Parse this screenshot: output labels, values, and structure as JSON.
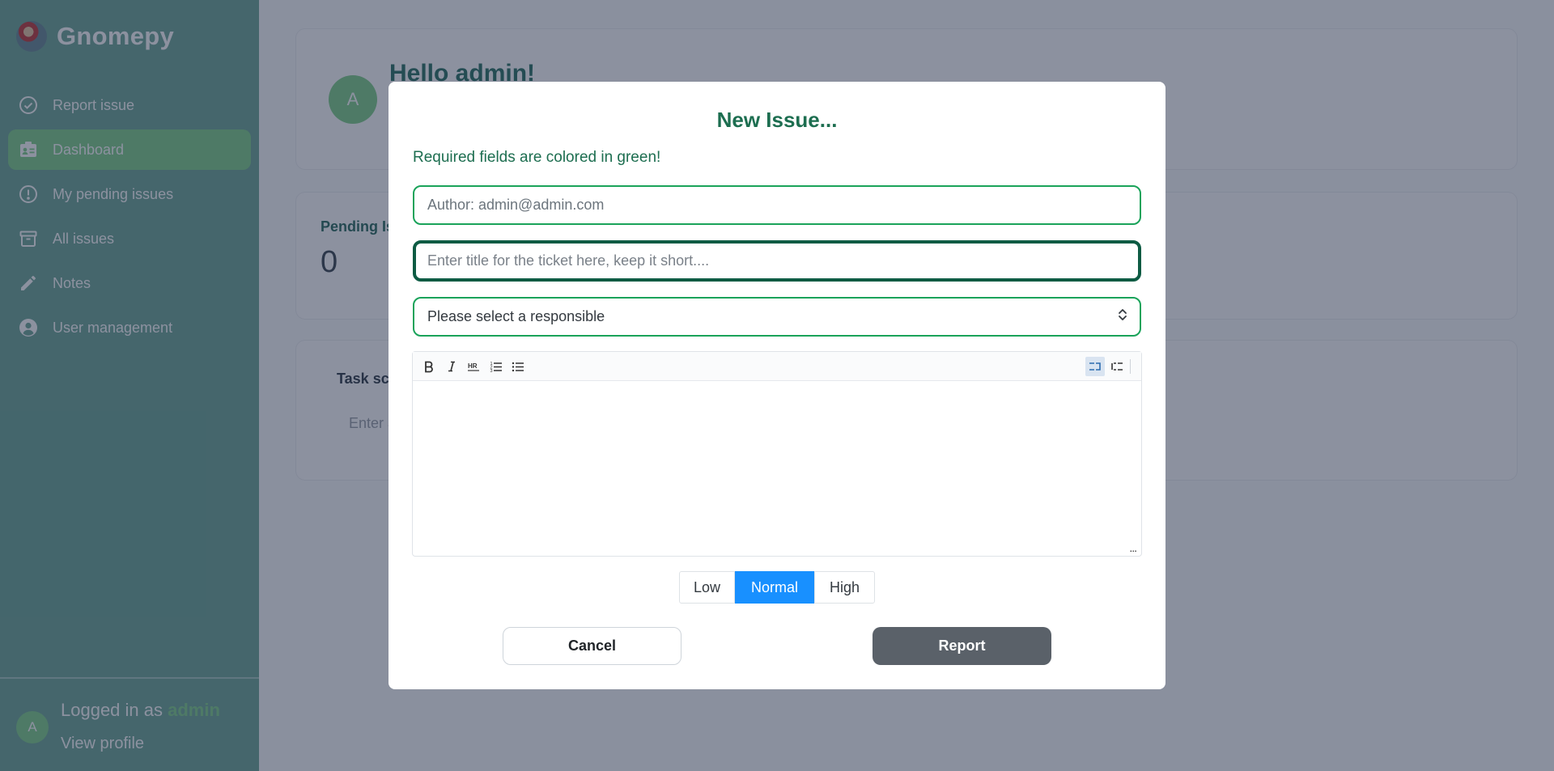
{
  "app": {
    "brand": "Gnomepy"
  },
  "sidebar": {
    "items": [
      {
        "label": "Report issue",
        "icon": "check-circle-icon"
      },
      {
        "label": "Dashboard",
        "icon": "id-card-icon"
      },
      {
        "label": "My pending issues",
        "icon": "exclamation-circle-icon"
      },
      {
        "label": "All issues",
        "icon": "archive-icon"
      },
      {
        "label": "Notes",
        "icon": "pencil-icon"
      },
      {
        "label": "User management",
        "icon": "user-circle-icon"
      }
    ],
    "active_item": "Dashboard",
    "footer": {
      "avatar_letter": "A",
      "logged_in_prefix": "Logged in as ",
      "username": "admin",
      "view_profile": "View profile"
    }
  },
  "dashboard": {
    "avatar_letter": "A",
    "greeting": "Hello admin!",
    "pending_title": "Pending Is",
    "pending_value": "0",
    "task_title": "Task sch",
    "task_placeholder": "Enter a"
  },
  "modal": {
    "title": "New Issue...",
    "required_note": "Required fields are colored in green!",
    "author_field": "Author: admin@admin.com",
    "title_placeholder": "Enter title for the ticket here, keep it short....",
    "responsible_select": "Please select a responsible",
    "editor": {
      "toolbar": [
        "bold-icon",
        "italic-icon",
        "hr-icon",
        "ordered-list-icon",
        "unordered-list-icon",
        "source-view-icon",
        "wysiwyg-view-icon"
      ],
      "resize_label": "..."
    },
    "priority": {
      "options": [
        "Low",
        "Normal",
        "High"
      ],
      "selected": "Normal"
    },
    "cancel_label": "Cancel",
    "report_label": "Report"
  },
  "colors": {
    "sidebar_bg": "#70a898",
    "accent_green": "#1aa35a",
    "title_green": "#1d6e50",
    "priority_selected": "#1890ff",
    "report_button": "#5a6169"
  }
}
